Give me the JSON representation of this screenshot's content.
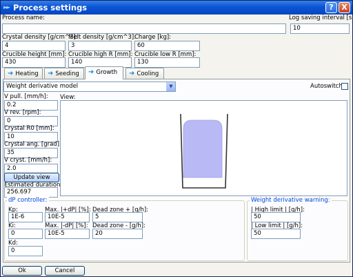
{
  "window": {
    "title": "Process settings",
    "help_label": "?",
    "close_label": "X"
  },
  "process": {
    "name_label": "Process name:",
    "name_value": "",
    "log_label": "Log saving interval [s]:",
    "log_value": "10"
  },
  "params": {
    "crystal_density_label": "Crystal density [g/cm^3]:",
    "crystal_density_value": "4",
    "melt_density_label": "Melt density [g/cm^3]:",
    "melt_density_value": "3",
    "charge_label": "Charge [kg]:",
    "charge_value": "60",
    "crucible_height_label": "Crucible height [mm]:",
    "crucible_height_value": "430",
    "crucible_high_r_label": "Crucible high R [mm]:",
    "crucible_high_r_value": "140",
    "crucible_low_r_label": "Crucible low R [mm]:",
    "crucible_low_r_value": "130"
  },
  "tabs": [
    {
      "label": "Heating"
    },
    {
      "label": "Seeding"
    },
    {
      "label": "Growth"
    },
    {
      "label": "Cooling"
    }
  ],
  "growth": {
    "model_selected": "Weight derivative model",
    "autoswitch_label": "Autoswitch",
    "view_label": "View:",
    "v_pull_label": "V pull. [mm/h]:",
    "v_pull_value": "0.2",
    "v_rev_label": "V rev. [rpm]:",
    "v_rev_value": "0",
    "crystal_r0_label": "Crystal R0 [mm]:",
    "crystal_r0_value": "10",
    "crystal_ang_label": "Crystal ang. [grad]:",
    "crystal_ang_value": "35",
    "v_cryst_label": "V cryst. [mm/h]:",
    "v_cryst_value": "2.0",
    "update_view_label": "Update view",
    "est_duration_label": "Estimated duration [h]:",
    "est_duration_value": "256.697"
  },
  "dp_controller": {
    "title": "dP controller:",
    "kp_label": "Kp:",
    "kp_value": "1E-6",
    "ki_label": "Ki:",
    "ki_value": "0",
    "kd_label": "Kd:",
    "kd_value": "0",
    "max_plus_label": "Max. |+dP| [%]:",
    "max_plus_value": "10E-5",
    "max_minus_label": "Max. |-dP| [%]:",
    "max_minus_value": "10E-5",
    "dead_plus_label": "Dead zone + [g/h]:",
    "dead_plus_value": "5",
    "dead_minus_label": "Dead zone - [g/h]:",
    "dead_minus_value": "20"
  },
  "weight_warning": {
    "title": "Weight derivative warning:",
    "high_label": "| High limit |   [g/h]:",
    "high_value": "50",
    "low_label": "| Low limit |    [g/h]:",
    "low_value": "50"
  },
  "footer": {
    "ok_label": "Ok",
    "cancel_label": "Cancel"
  },
  "colors": {
    "title_bar": "#0a55d6",
    "crystal_fill": "#b9b9f6",
    "group_title": "#0046d5"
  }
}
